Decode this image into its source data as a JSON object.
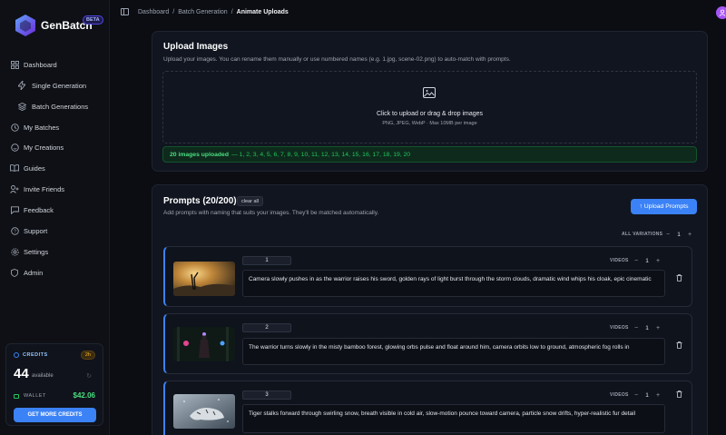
{
  "brand": {
    "name": "GenBatch",
    "badge": "BETA"
  },
  "sidebar": {
    "items": [
      {
        "label": "Dashboard",
        "icon": "dashboard-icon"
      },
      {
        "label": "Single Generation",
        "icon": "lightning-icon"
      },
      {
        "label": "Batch Generations",
        "icon": "layers-icon"
      },
      {
        "label": "My Batches",
        "icon": "clock-icon"
      },
      {
        "label": "My Creations",
        "icon": "chat-icon"
      },
      {
        "label": "Guides",
        "icon": "book-icon"
      },
      {
        "label": "Invite Friends",
        "icon": "user-plus-icon"
      },
      {
        "label": "Feedback",
        "icon": "message-icon"
      },
      {
        "label": "Support",
        "icon": "life-buoy-icon"
      },
      {
        "label": "Settings",
        "icon": "gear-icon"
      },
      {
        "label": "Admin",
        "icon": "shield-icon"
      }
    ]
  },
  "credits": {
    "label": "CREDITS",
    "badge": "2h",
    "amount": "44",
    "available_label": "available",
    "wallet_label": "WALLET",
    "wallet_amount": "$42.06",
    "button": "GET MORE CREDITS"
  },
  "header": {
    "breadcrumbs": [
      "Dashboard",
      "/",
      "Batch Generation",
      "/",
      "Animate Uploads"
    ]
  },
  "upload": {
    "title": "Upload Images",
    "subtitle": "Upload your images. You can rename them manually or use numbered names (e.g. 1.jpg, scene-02.png) to auto-match with prompts.",
    "drop_title": "Click to upload or drag & drop images",
    "drop_sub": "PNG, JPEG, WebP · Max 10MB per image",
    "uploaded_count": "20 images uploaded",
    "uploaded_list": "— 1, 2, 3, 4, 5, 6, 7, 8, 9, 10, 11, 12, 13, 14, 15, 16, 17, 18, 19, 20"
  },
  "prompts": {
    "title": "Prompts (20/200)",
    "clear_label": "clear all",
    "subtitle": "Add prompts with naming that suits your images. They'll be matched automatically.",
    "upload_button": "↑ Upload Prompts",
    "all_variations_label": "ALL VARIATIONS",
    "all_variations_value": "1",
    "videos_label": "VIDEOS",
    "items": [
      {
        "number": "1",
        "videos": "1",
        "text": "Camera slowly pushes in as the warrior raises his sword, golden rays of light burst through the storm clouds, dramatic wind whips his cloak, epic cinematic"
      },
      {
        "number": "2",
        "videos": "1",
        "text": "The warrior turns slowly in the misty bamboo forest, glowing orbs pulse and float around him, camera orbits low to ground, atmospheric fog rolls in"
      },
      {
        "number": "3",
        "videos": "1",
        "text": "Tiger stalks forward through swirling snow, breath visible in cold air, slow-motion pounce toward camera, particle snow drifts, hyper-realistic fur detail"
      }
    ]
  },
  "colors": {
    "accent": "#3b82f6",
    "success": "#22c55e",
    "wallet": "#4ade80"
  }
}
